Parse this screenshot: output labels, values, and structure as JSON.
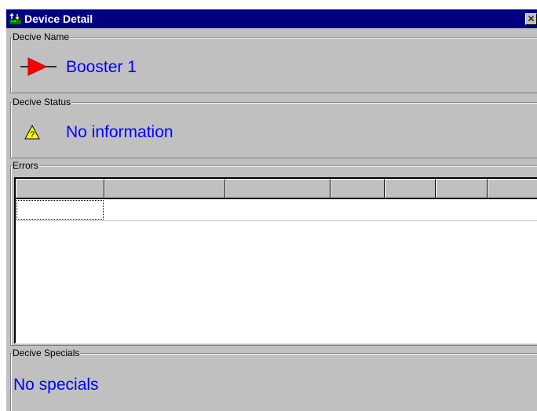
{
  "window": {
    "title": "Device Detail",
    "close_glyph": "✕",
    "title_color": "#000080",
    "icon": "device-app-icon"
  },
  "device_name": {
    "group_label": "Decive Name",
    "value": "Booster 1",
    "icon": "red-arrow-icon",
    "icon_color": "#ff0000"
  },
  "device_status": {
    "group_label": "Decive Status",
    "value": "No information",
    "icon": "warning-icon",
    "icon_color": "#ffff00"
  },
  "errors": {
    "group_label": "Errors",
    "columns": [
      "",
      "",
      "",
      "",
      "",
      "",
      ""
    ],
    "rows": [
      [
        "",
        "",
        "",
        "",
        "",
        "",
        ""
      ]
    ]
  },
  "device_specials": {
    "group_label": "Decive Specials",
    "value": "No specials"
  },
  "colors": {
    "accent_text": "#0000ff",
    "face": "#c0c0c0"
  }
}
